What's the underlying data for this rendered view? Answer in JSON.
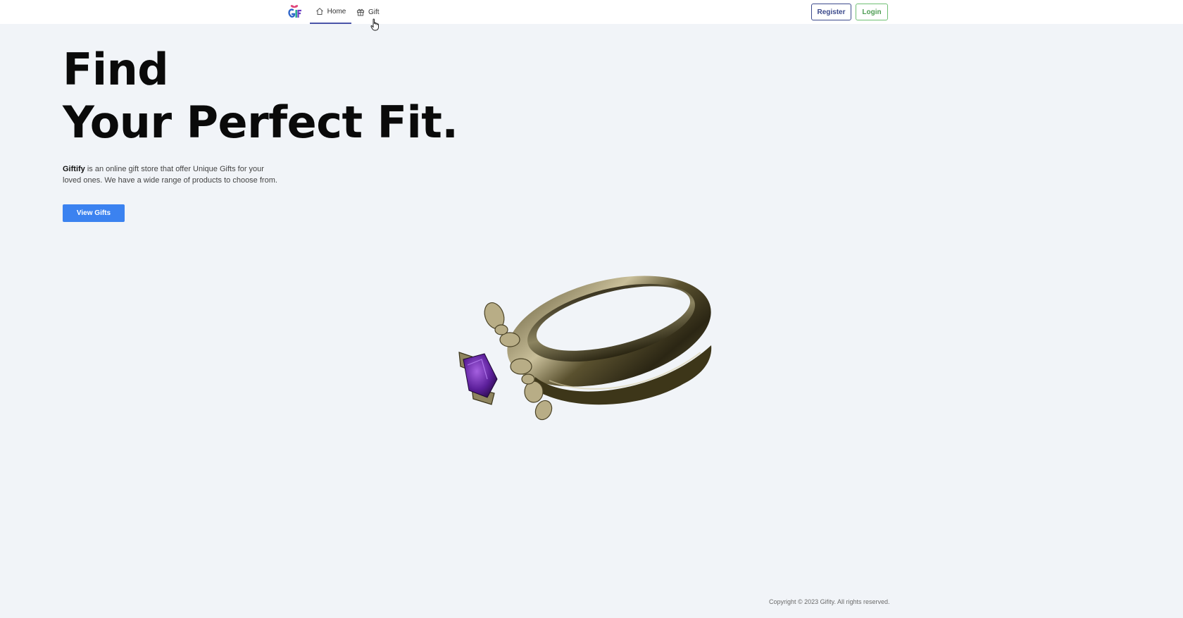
{
  "nav": {
    "logo_text": "GIFT",
    "items": [
      {
        "label": "Home",
        "icon": "home-icon",
        "active": true
      },
      {
        "label": "Gift",
        "icon": "gift-icon",
        "active": false
      }
    ],
    "register_label": "Register",
    "login_label": "Login"
  },
  "hero": {
    "line1": "Find",
    "line2": "Your Perfect Fit.",
    "brand": "Giftify",
    "description": " is an online gift store that offer Unique Gifts for your loved ones. We have a wide range of products to choose from.",
    "cta_label": "View Gifts"
  },
  "footer": {
    "copyright": "Copyright © 2023 Gifity. All rights reserved."
  },
  "colors": {
    "background": "#f1f4f8",
    "primary_button": "#3b82f0",
    "register_border": "#3c4a8c",
    "login_border": "#6fbf73",
    "active_underline": "#4a54a8"
  }
}
